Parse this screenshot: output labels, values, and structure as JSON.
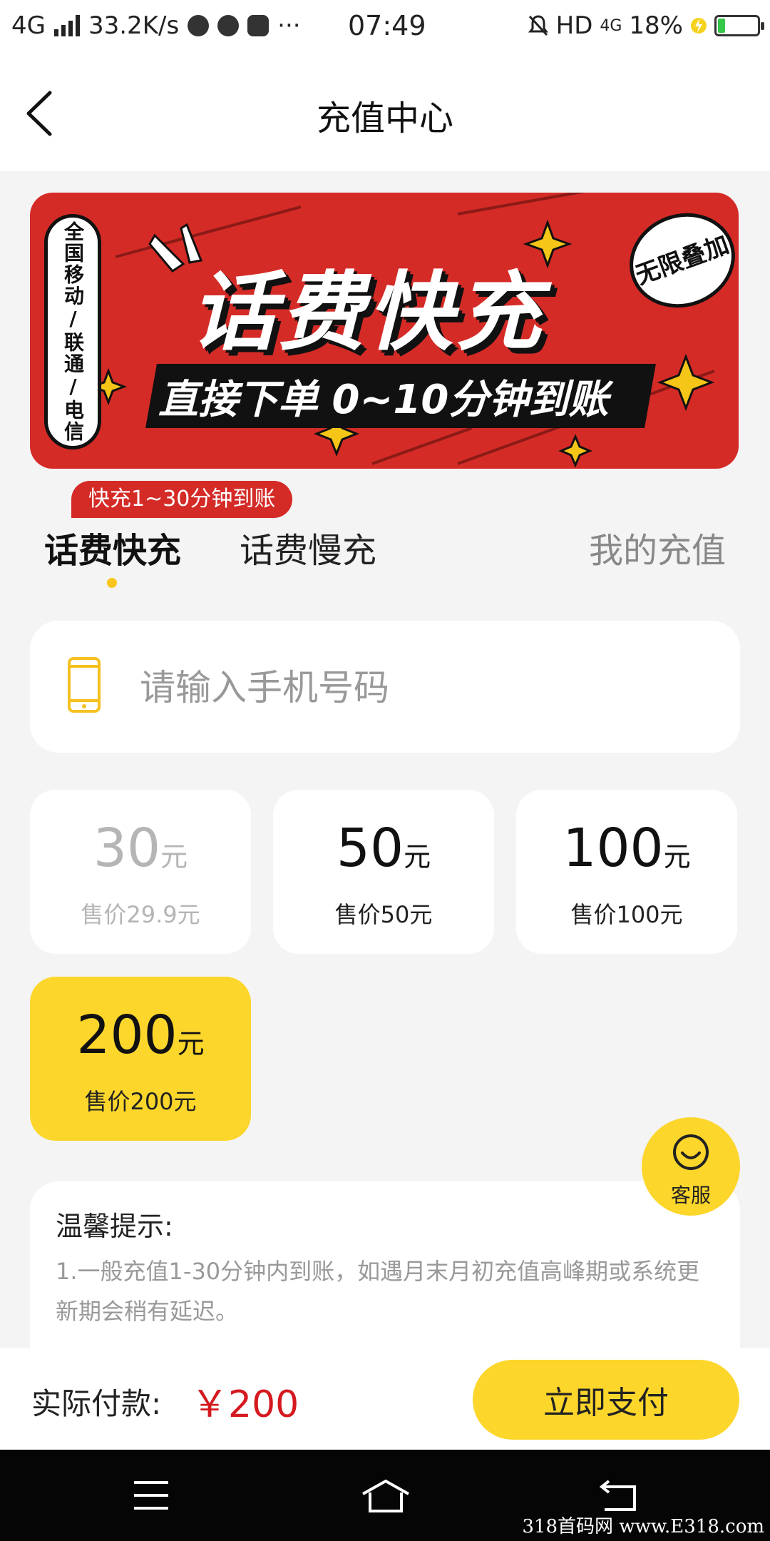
{
  "status_bar": {
    "network": "4G",
    "speed": "33.2K/s",
    "more": "···",
    "time": "07:49",
    "hd": "HD",
    "net_right": "4G",
    "battery": "18%",
    "battery_level": 0.18
  },
  "header": {
    "title": "充值中心"
  },
  "banner": {
    "carriers": "全国移动/联通/电信",
    "headline": "话费快充",
    "subline": "直接下单  0~10分钟到账",
    "badge": "无限叠加"
  },
  "tabs": {
    "promo_badge": "快充1~30分钟到账",
    "fast": "话费快充",
    "slow": "话费慢充",
    "mine": "我的充值"
  },
  "phone": {
    "placeholder": "请输入手机号码"
  },
  "amounts": [
    {
      "value": "30",
      "unit": "元",
      "price": "售价29.9元",
      "state": "disabled"
    },
    {
      "value": "50",
      "unit": "元",
      "price": "售价50元",
      "state": "normal"
    },
    {
      "value": "100",
      "unit": "元",
      "price": "售价100元",
      "state": "normal"
    },
    {
      "value": "200",
      "unit": "元",
      "price": "售价200元",
      "state": "selected"
    }
  ],
  "service": {
    "label": "客服"
  },
  "tips": {
    "title": "温馨提示:",
    "text": "1.一般充值1-30分钟内到账，如遇月末月初充值高峰期或系统更新期会稍有延迟。"
  },
  "footer": {
    "pay_label": "实际付款:",
    "pay_amount": "￥200",
    "pay_button": "立即支付"
  },
  "watermark": "318首码网 www.E318.com",
  "colors": {
    "accent_yellow": "#fcd62b",
    "banner_red": "#d42b27",
    "price_red": "#d4191f"
  }
}
